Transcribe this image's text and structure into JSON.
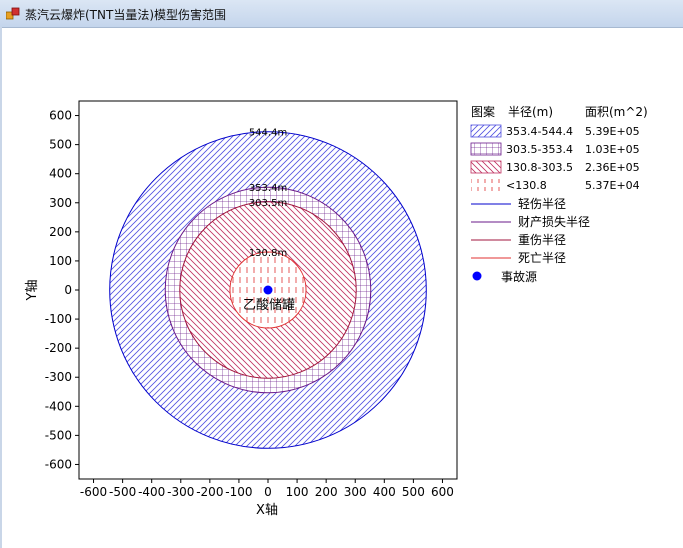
{
  "window": {
    "title": "蒸汽云爆炸(TNT当量法)模型伤害范围"
  },
  "colors": {
    "blue": "#0000cc",
    "purple": "#6a1a8a",
    "maroon": "#a0143c",
    "red": "#e03030",
    "source": "#0000ff"
  },
  "chart_data": {
    "type": "scatter",
    "xlabel": "X轴",
    "ylabel": "Y轴",
    "xlim": [
      -650,
      650
    ],
    "ylim": [
      -650,
      650
    ],
    "xticks": [
      -600,
      -500,
      -400,
      -300,
      -200,
      -100,
      0,
      100,
      200,
      300,
      400,
      500,
      600
    ],
    "yticks": [
      -600,
      -500,
      -400,
      -300,
      -200,
      -100,
      0,
      100,
      200,
      300,
      400,
      500,
      600
    ],
    "grid": false,
    "legend_position": "right",
    "circles": [
      {
        "radius": 544.4,
        "label": "544.4m",
        "name": "轻伤半径",
        "pattern": "diag-fwd",
        "color": "#0000cc"
      },
      {
        "radius": 353.4,
        "label": "353.4m",
        "name": "财产损失半径",
        "pattern": "grid",
        "color": "#6a1a8a"
      },
      {
        "radius": 303.5,
        "label": "303.5m",
        "name": "重伤半径",
        "pattern": "diag-back",
        "color": "#a0143c"
      },
      {
        "radius": 130.8,
        "label": "130.8m",
        "name": "死亡半径",
        "pattern": "vertical",
        "color": "#e03030"
      }
    ],
    "source": {
      "x": 0,
      "y": 0,
      "label": "乙酸储罐",
      "legend": "事故源"
    },
    "legend": {
      "headers": {
        "pattern": "图案",
        "radius": "半径(m)",
        "area": "面积(m^2)"
      },
      "rows": [
        {
          "range": "353.4-544.4",
          "area": "5.39E+05",
          "pattern": "diag-fwd",
          "color": "#5050e0"
        },
        {
          "range": "303.5-353.4",
          "area": "1.03E+05",
          "pattern": "grid",
          "color": "#6a1a8a"
        },
        {
          "range": "130.8-303.5",
          "area": "2.36E+05",
          "pattern": "diag-back",
          "color": "#c03060"
        },
        {
          "range": "<130.8",
          "area": "5.37E+04",
          "pattern": "vertical",
          "color": "#e03030"
        }
      ],
      "lines": [
        {
          "label": "轻伤半径",
          "color": "#0000cc"
        },
        {
          "label": "财产损失半径",
          "color": "#6a1a8a"
        },
        {
          "label": "重伤半径",
          "color": "#a0143c"
        },
        {
          "label": "死亡半径",
          "color": "#e03030"
        }
      ]
    }
  }
}
